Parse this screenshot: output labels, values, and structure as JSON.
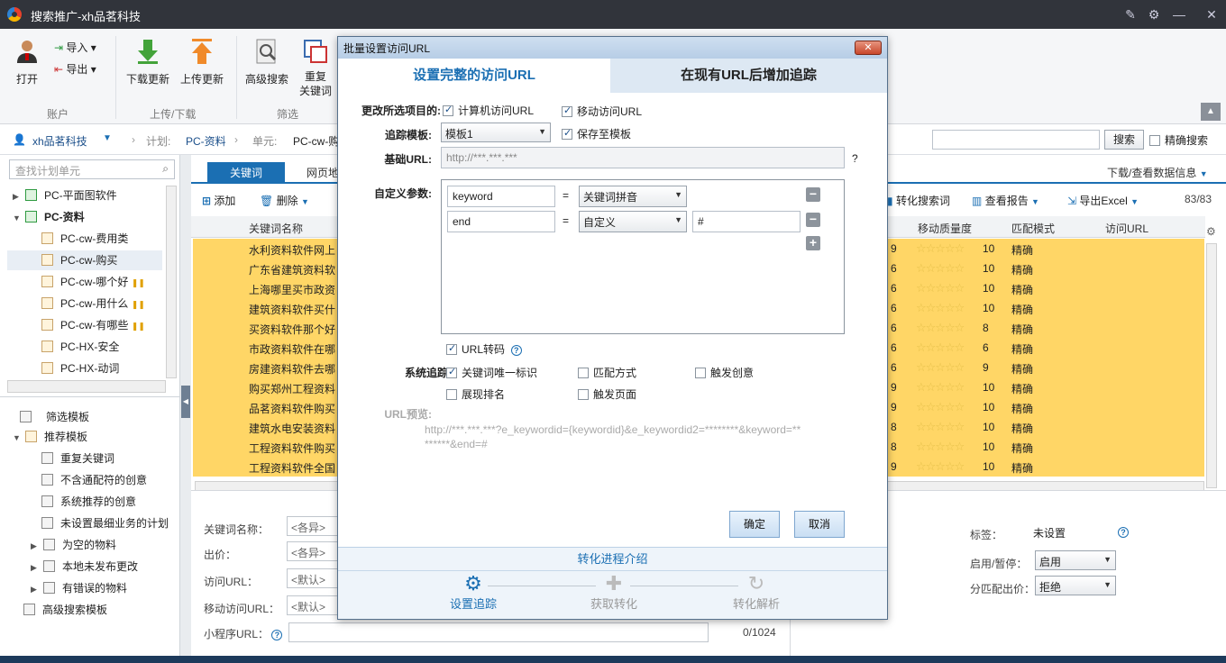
{
  "window": {
    "title": "搜索推广-xh品茗科技"
  },
  "toolbar": {
    "open": "打开",
    "import": "导入",
    "export": "导出",
    "download_update": "下载更新",
    "upload_update": "上传更新",
    "advanced_search": "高级搜索",
    "repeat_keyword": "重复\n关键词",
    "group_account": "账户",
    "group_updown": "上传/下载",
    "group_filter": "筛选"
  },
  "address": {
    "account": "xh品茗科技",
    "plan_label": "计划:",
    "plan": "PC-资料",
    "unit_label": "单元:",
    "unit": "PC-cw-购",
    "search_button": "搜索",
    "exact_search": "精确搜索"
  },
  "left": {
    "search_placeholder": "查找计划单元",
    "tree": [
      {
        "label": "PC-平面图软件",
        "level": 0,
        "expanded": false
      },
      {
        "label": "PC-资料",
        "level": 0,
        "expanded": true
      },
      {
        "label": "PC-cw-费用类",
        "level": 1
      },
      {
        "label": "PC-cw-购买",
        "level": 1
      },
      {
        "label": "PC-cw-哪个好",
        "level": 1
      },
      {
        "label": "PC-cw-用什么",
        "level": 1
      },
      {
        "label": "PC-cw-有哪些",
        "level": 1
      },
      {
        "label": "PC-HX-安全",
        "level": 1
      },
      {
        "label": "PC-HX-动词",
        "level": 1
      }
    ],
    "filter_template": "筛选模板",
    "recommend_template": "推荐模板",
    "recommend_items": [
      "重复关键词",
      "不含通配符的创意",
      "系统推荐的创意",
      "未设置最细业务的计划",
      "为空的物料",
      "本地未发布更改",
      "有错误的物料"
    ],
    "advanced_template": "高级搜索模板"
  },
  "main": {
    "tab_keyword": "关键词",
    "tab_webpage": "网页地",
    "add": "添加",
    "delete": "删除",
    "download_data": "下载/查看数据信息",
    "convert_search": "转化搜索词",
    "view_report": "查看报告",
    "export_excel": "导出Excel",
    "count": "83/83",
    "col_keyword": "关键词名称",
    "col_quality": "移动质量度",
    "col_match": "匹配模式",
    "col_url": "访问URL",
    "rows": [
      {
        "kw": "水利资料软件网上",
        "q": "9",
        "mq": "10",
        "m": "精确"
      },
      {
        "kw": "广东省建筑资料软",
        "q": "6",
        "mq": "10",
        "m": "精确"
      },
      {
        "kw": "上海哪里买市政资",
        "q": "6",
        "mq": "10",
        "m": "精确"
      },
      {
        "kw": "建筑资料软件买什",
        "q": "6",
        "mq": "10",
        "m": "精确"
      },
      {
        "kw": "买资料软件那个好",
        "q": "6",
        "mq": "8",
        "m": "精确"
      },
      {
        "kw": "市政资料软件在哪",
        "q": "6",
        "mq": "6",
        "m": "精确"
      },
      {
        "kw": "房建资料软件去哪",
        "q": "6",
        "mq": "9",
        "m": "精确"
      },
      {
        "kw": "购买郑州工程资料",
        "q": "9",
        "mq": "10",
        "m": "精确"
      },
      {
        "kw": "品茗资料软件购买",
        "q": "9",
        "mq": "10",
        "m": "精确"
      },
      {
        "kw": "建筑水电安装资料",
        "q": "8",
        "mq": "10",
        "m": "精确"
      },
      {
        "kw": "工程资料软件购买",
        "q": "8",
        "mq": "10",
        "m": "精确"
      },
      {
        "kw": "工程资料软件全国",
        "q": "9",
        "mq": "10",
        "m": "精确"
      }
    ],
    "bottom": {
      "kw_name": "关键词名称：",
      "kw_value": "<各异>",
      "bid": "出价：",
      "bid_value": "<各异>",
      "url": "访问URL：",
      "url_value": "<默认>",
      "mobile_url": "移动访问URL：",
      "mobile_value": "<默认>",
      "mini_url": "小程序URL：",
      "mini_count": "0/1024",
      "tag": "标签：",
      "tag_value": "未设置",
      "enable": "启用/暂停：",
      "enable_value": "启用",
      "split_bid": "分匹配出价：",
      "split_value": "拒绝"
    }
  },
  "dialog": {
    "title": "批量设置访问URL",
    "tab_full": "设置完整的访问URL",
    "tab_append": "在现有URL后增加追踪",
    "change_items_label": "更改所选项目的:",
    "pc_url": "计算机访问URL",
    "mobile_url": "移动访问URL",
    "template_label": "追踪模板:",
    "template_value": "模板1",
    "save_template": "保存至模板",
    "base_url_label": "基础URL:",
    "base_url_placeholder": "http://***.***.***",
    "custom_params_label": "自定义参数:",
    "params": [
      {
        "name": "keyword",
        "type": "关键词拼音",
        "value": ""
      },
      {
        "name": "end",
        "type": "自定义",
        "value": "#"
      }
    ],
    "url_encode": "URL转码",
    "system_track_label": "系统追踪:",
    "track_kw_id": "关键词唯一标识",
    "track_match": "匹配方式",
    "track_creative": "触发创意",
    "track_rank": "展现排名",
    "track_page": "触发页面",
    "preview_label": "URL预览:",
    "preview_text": "http://***.***.***?e_keywordid={keywordid}&e_keywordid2=********&keyword=**\n******&end=#",
    "ok": "确定",
    "cancel": "取消",
    "conv_intro": "转化进程介绍",
    "steps": [
      "设置追踪",
      "获取转化",
      "转化解析"
    ]
  },
  "colors": {
    "accent": "#1b6fb3",
    "row_highlight": "#ffd666"
  }
}
